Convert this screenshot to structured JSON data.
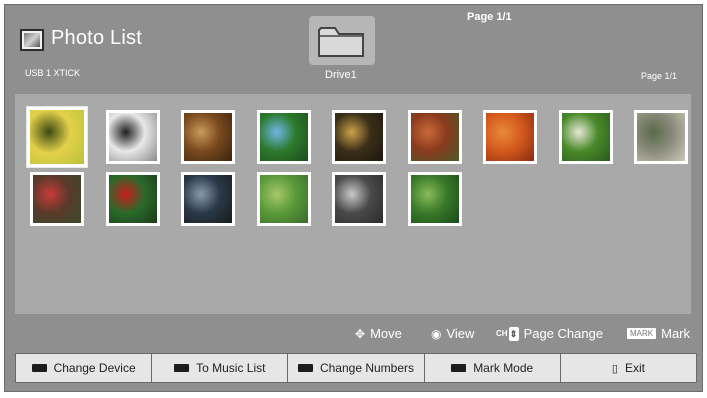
{
  "header": {
    "title": "Photo List",
    "device": "USB 1 XTICK",
    "drive": "Drive1",
    "page_top": "Page 1/1",
    "page_right": "Page 1/1"
  },
  "thumbnails": [
    {
      "name": "photo-yellow-butterfly",
      "colors": [
        "#e3d04a",
        "#3d4a14",
        "#b9c23a"
      ]
    },
    {
      "name": "photo-black-white-animal",
      "colors": [
        "#e8e8e8",
        "#1e1e1e",
        "#8a8a8a"
      ]
    },
    {
      "name": "photo-wooden-interior",
      "colors": [
        "#7a4a1e",
        "#c99a5a",
        "#3a2410"
      ]
    },
    {
      "name": "photo-blue-flowers",
      "colors": [
        "#2d7a2d",
        "#6fb6e8",
        "#1b4d1b"
      ]
    },
    {
      "name": "photo-sunset",
      "colors": [
        "#3b2f18",
        "#caa24a",
        "#1d1710"
      ]
    },
    {
      "name": "photo-red-tree",
      "colors": [
        "#8a3a1e",
        "#c86a3a",
        "#4a5a2a"
      ]
    },
    {
      "name": "photo-orange-fruits",
      "colors": [
        "#d45a1e",
        "#e88a3a",
        "#8a2a10"
      ]
    },
    {
      "name": "photo-dandelion",
      "colors": [
        "#4a8a2a",
        "#e8e8d8",
        "#2a5a1a"
      ]
    },
    {
      "name": "photo-rocks-water",
      "colors": [
        "#8a8a7a",
        "#5a6a4a",
        "#cacaba"
      ]
    },
    {
      "name": "photo-red-berries",
      "colors": [
        "#5a3a2a",
        "#c83a3a",
        "#3a4a2a"
      ]
    },
    {
      "name": "photo-red-rose",
      "colors": [
        "#2a6a2a",
        "#c81e1e",
        "#1a3a1a"
      ]
    },
    {
      "name": "photo-stone-basin",
      "colors": [
        "#2a3a4a",
        "#8a9aaa",
        "#1a1a1a"
      ]
    },
    {
      "name": "photo-tea-field",
      "colors": [
        "#5a9a3a",
        "#a8c86a",
        "#3a6a2a"
      ]
    },
    {
      "name": "photo-columns",
      "colors": [
        "#4a4a4a",
        "#cacaca",
        "#2a2a2a"
      ]
    },
    {
      "name": "photo-green-forest",
      "colors": [
        "#3a7a2a",
        "#8aba5a",
        "#1a4a1a"
      ]
    }
  ],
  "keys": {
    "move": "Move",
    "view": "View",
    "ch": "CH",
    "page_change": "Page Change",
    "mark_badge": "MARK",
    "mark": "Mark"
  },
  "buttons": [
    {
      "label": "Change Device",
      "icon": "black-key-icon"
    },
    {
      "label": "To Music List",
      "icon": "black-key-icon"
    },
    {
      "label": "Change Numbers",
      "icon": "black-key-icon"
    },
    {
      "label": "Mark Mode",
      "icon": "black-key-icon"
    },
    {
      "label": "Exit",
      "icon": "exit-icon"
    }
  ]
}
